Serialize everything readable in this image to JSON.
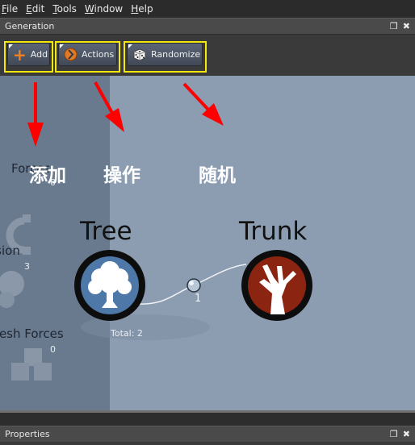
{
  "menubar": {
    "items": [
      {
        "label": "File"
      },
      {
        "label": "Edit"
      },
      {
        "label": "Tools"
      },
      {
        "label": "Window"
      },
      {
        "label": "Help"
      }
    ]
  },
  "generation_panel": {
    "title": "Generation",
    "toolbar": {
      "add_label": "Add",
      "actions_label": "Actions",
      "randomize_label": "Randomize"
    }
  },
  "annotations": {
    "add": "添加",
    "actions": "操作",
    "randomize": "随机"
  },
  "sidebar": {
    "items": [
      {
        "label": "Forces",
        "count": "0"
      },
      {
        "label": "Collision",
        "count": "3"
      },
      {
        "label": "Mesh Forces",
        "count": "0"
      }
    ]
  },
  "graph": {
    "tree_title": "Tree",
    "trunk_title": "Trunk",
    "total_label": "Total: 2",
    "link_count": "1"
  },
  "properties_panel": {
    "title": "Properties"
  },
  "colors": {
    "highlight": "#f5e90c",
    "arrow": "#ff0000",
    "tree_node": "#4e78a8",
    "trunk_node": "#8b2410",
    "canvas": "#8c9db2"
  }
}
